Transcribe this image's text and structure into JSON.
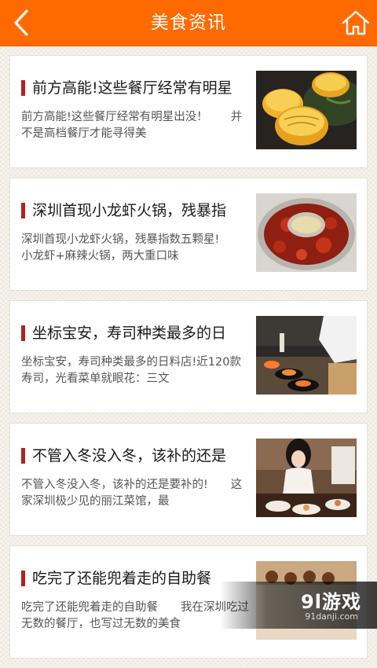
{
  "header": {
    "title": "美食资讯",
    "back_icon": "chevron-left-icon",
    "home_icon": "home-icon",
    "bg_color": "#ff6a00"
  },
  "articles": [
    {
      "title": "前方高能!这些餐厅经常有明星",
      "summary": "前方高能!这些餐厅经常有明星出没！　　并不是高档餐厅才能寻得美",
      "image": "baked-buns-photo"
    },
    {
      "title": "深圳首现小龙虾火锅，残暴指",
      "summary": "深圳首现小龙虾火锅，残暴指数五颗星!　　小龙虾+麻辣火锅，两大重口味",
      "image": "crayfish-hotpot-photo"
    },
    {
      "title": "坐标宝安，寿司种类最多的日",
      "summary": "坐标宝安，寿司种类最多的日料店!近120款寿司，光看菜单就眼花：三文",
      "image": "sushi-chef-photo"
    },
    {
      "title": "不管入冬没入冬，该补的还是",
      "summary": "不管入冬没入冬，该补的还是要补的!　　这家深圳极少见的丽江菜馆，最",
      "image": "restaurant-woman-photo"
    },
    {
      "title": "吃完了还能兜着走的自助餐",
      "summary": "吃完了还能兜着走的自助餐　　我在深圳吃过无数的餐厅，也写过无数的美食",
      "image": "buffet-photo"
    }
  ],
  "watermark": {
    "logo": "9l游戏",
    "url": "91danji.com"
  },
  "colors": {
    "accent_bar": "#b22222",
    "card_bg": "#ffffff"
  }
}
